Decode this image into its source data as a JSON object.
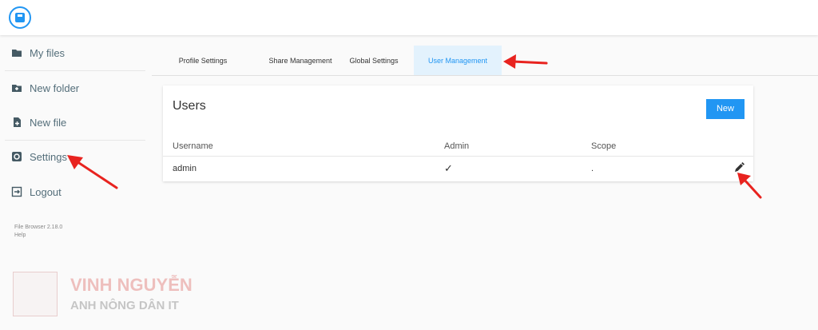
{
  "sidebar": {
    "items": [
      {
        "label": "My files",
        "icon": "folder-icon"
      },
      {
        "label": "New folder",
        "icon": "new-folder-icon"
      },
      {
        "label": "New file",
        "icon": "new-file-icon"
      },
      {
        "label": "Settings",
        "icon": "settings-icon"
      },
      {
        "label": "Logout",
        "icon": "logout-icon"
      }
    ],
    "version": "File Browser 2.18.0",
    "help": "Help"
  },
  "tabs": [
    {
      "label": "Profile Settings"
    },
    {
      "label": "Share Management"
    },
    {
      "label": "Global Settings"
    },
    {
      "label": "User Management",
      "active": true
    }
  ],
  "users_card": {
    "title": "Users",
    "new_label": "New",
    "columns": [
      "Username",
      "Admin",
      "Scope"
    ],
    "rows": [
      {
        "username": "admin",
        "admin": "✓",
        "scope": "."
      }
    ]
  },
  "watermark": {
    "title": "VINH NGUYỄN",
    "subtitle": "ANH NÔNG DÂN IT"
  },
  "colors": {
    "accent": "#2196f3",
    "annotation_arrow": "#e8231f",
    "sidebar_text": "#546e7a"
  }
}
